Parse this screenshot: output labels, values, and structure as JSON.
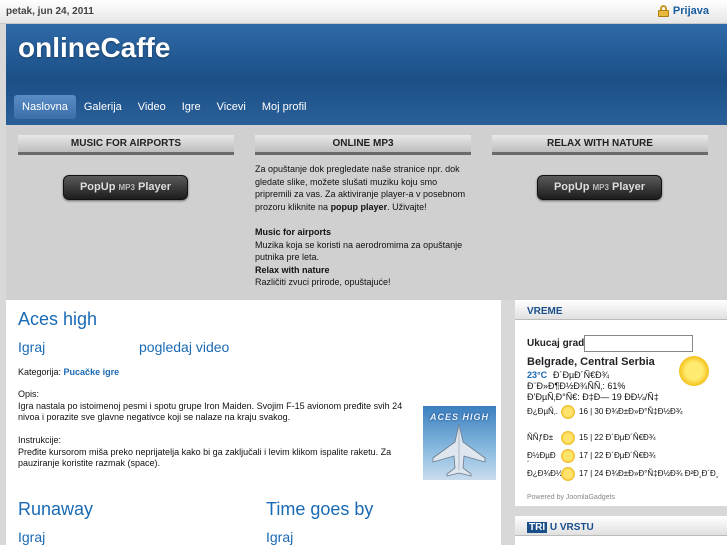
{
  "topbar": {
    "date": "petak, jun 24, 2011",
    "login_label": "Prijava"
  },
  "site": {
    "logo": "onlineCaffe"
  },
  "nav": {
    "items": [
      "Naslovna",
      "Galerija",
      "Video",
      "Igre",
      "Vicevi",
      "Moj profil"
    ]
  },
  "feature": {
    "left_title": "MUSIC FOR AIRPORTS",
    "mid_title": "ONLINE MP3",
    "right_title": "RELAX WITH NATURE",
    "player_label": "PopUp",
    "player_small": "MP3",
    "player_label2": "Player",
    "mid_intro": "Za opuštanje dok pregledate naše stranice npr. dok gledate slike, možete slušati muziku koju smo pripremili za vas. Za aktiviranje player-a v posebnom prozoru kliknite na",
    "mid_intro_bold": "popup player",
    "mid_intro_end": ". Uživajte!",
    "airports_title": "Music for airports",
    "airports_text": "Muzika koja se koristi na aerodromima za opuštanje putnika pre leta.",
    "nature_title": "Relax with nature",
    "nature_text": "Različiti zvuci prirode, opuštajuće!"
  },
  "main": {
    "game_title": "Aces high",
    "play_link": "Igraj",
    "video_link": "pogledaj video",
    "category_label": "Kategorija:",
    "category_value": "Pucačke igre",
    "desc_label": "Opis:",
    "desc_text": "Igra nastala po istoimenoj pesmi i spotu grupe Iron Maiden. Svojim F-15 avionom pređite svih 24 nivoa i porazite sve glavne negativce koji se nalaze na kraju svakog.",
    "instr_label": "Instrukcije:",
    "instr_text": "Pređite kursorom miša preko neprijatelja kako bi ga zaključali i levim klikom ispalite raketu. Za pauziranje koristite razmak (space).",
    "thumb_title": "ACES HIGH",
    "game2_title": "Runaway",
    "game2_play": "Igraj",
    "game3_title": "Time goes by",
    "game3_play": "Igraj"
  },
  "weather": {
    "header": "VREME",
    "city_label": "Ukucaj grad:",
    "city_input_value": "",
    "location": "Belgrade, Central Serbia",
    "temp": "23°C",
    "line1": "Ð´ÐµÐ´Ñ€Ð¾",
    "line2": "Ð¨Ð»Ð¶Ð½Ð¾ÑÑ‚: 61%",
    "line3": "Ð’ÐµÑ‚Ð°Ñ€: Ð‡Ð— 19 Ð­Ð¼/Ñ‡",
    "forecast": [
      {
        "day": "Ð¿ÐµÑ‚.",
        "value": "16 | 30  Ð¾Ð±Ð»Ð°Ñ‡Ð½Ð¾"
      },
      {
        "day": "ÑÑƒÐ±",
        "value": "15 | 22  Ð´ÐµÐ´Ñ€Ð¾"
      },
      {
        "day": "Ð½ÐµÐ´",
        "value": "17 | 22  Ð´ÐµÐ´Ñ€Ð¾"
      },
      {
        "day": "Ð¿Ð¾Ð½",
        "value": "17 | 24  Ð¾Ð±Ð»Ð°Ñ‡Ð½Ð¾ Ð²Ð¸Ð´Ð¸"
      }
    ],
    "powered": "Powered by JoomlaGadgets"
  },
  "rank": {
    "header_highlight": "TRI",
    "header_rest": "U VRSTU"
  },
  "colors": {
    "link": "#1a6ab4",
    "header_bg": "#1b4f86",
    "page_bg": "#d8d8d8"
  }
}
